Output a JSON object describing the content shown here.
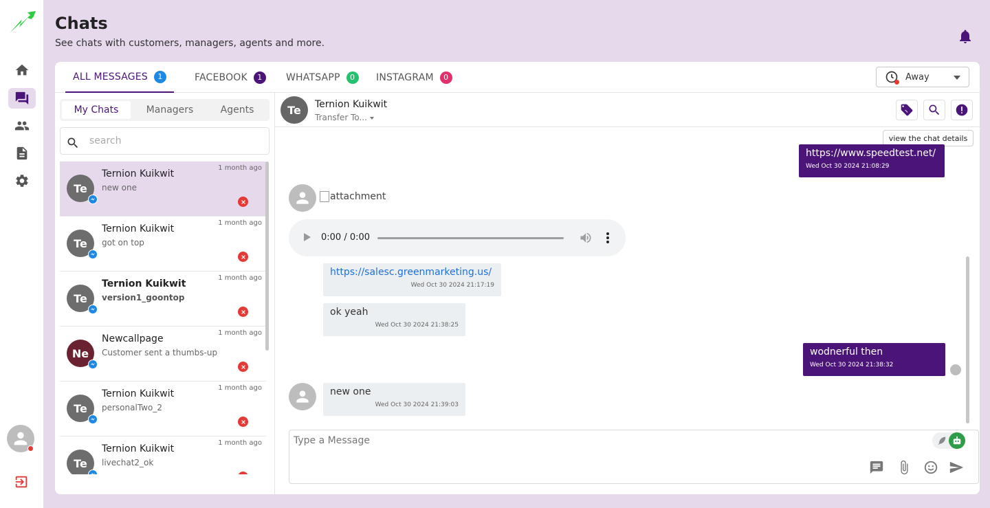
{
  "colors": {
    "brand_purple": "#4a1478",
    "page_bg": "#e6d9ec",
    "messenger_blue": "#1e88e5",
    "alert_red": "#e53935",
    "whatsapp_green": "#25c16f",
    "instagram_pink": "#e0306f",
    "bot_green": "#2e9d4a"
  },
  "header": {
    "title": "Chats",
    "subtitle": "See chats with customers, managers, agents and more."
  },
  "sidebar": {
    "items": [
      {
        "name": "home",
        "icon": "home-icon"
      },
      {
        "name": "chats",
        "icon": "chat-icon"
      },
      {
        "name": "contacts",
        "icon": "people-icon"
      },
      {
        "name": "documents",
        "icon": "document-icon"
      },
      {
        "name": "settings",
        "icon": "gear-icon"
      }
    ]
  },
  "channel_tabs": [
    {
      "label": "ALL MESSAGES",
      "count": "1",
      "color": "#1e88e5"
    },
    {
      "label": "FACEBOOK",
      "count": "1",
      "color": "#4a1478"
    },
    {
      "label": "WHATSAPP",
      "count": "0",
      "color": "#25c16f"
    },
    {
      "label": "INSTAGRAM",
      "count": "0",
      "color": "#e0306f"
    }
  ],
  "status": {
    "selected": "Away"
  },
  "subtabs": [
    "My Chats",
    "Managers",
    "Agents"
  ],
  "search": {
    "placeholder": "search"
  },
  "chats": [
    {
      "name": "Ternion Kuikwit",
      "initials": "Te",
      "preview": "new one",
      "time": "1 month ago",
      "avatar_color": "#6d6d6d",
      "unread": false
    },
    {
      "name": "Ternion Kuikwit",
      "initials": "Te",
      "preview": "got on top",
      "time": "1 month ago",
      "avatar_color": "#6d6d6d",
      "unread": false
    },
    {
      "name": "Ternion Kuikwit",
      "initials": "Te",
      "preview": "version1_goontop",
      "time": "1 month ago",
      "avatar_color": "#6d6d6d",
      "unread": true
    },
    {
      "name": "Newcallpage",
      "initials": "Ne",
      "preview": "Customer sent a thumbs-up",
      "time": "1 month ago",
      "avatar_color": "#6b2230",
      "unread": false
    },
    {
      "name": "Ternion Kuikwit",
      "initials": "Te",
      "preview": "personalTwo_2",
      "time": "1 month ago",
      "avatar_color": "#6d6d6d",
      "unread": false
    },
    {
      "name": "Ternion Kuikwit",
      "initials": "Te",
      "preview": "livechat2_ok",
      "time": "1 month ago",
      "avatar_color": "#6d6d6d",
      "unread": false
    }
  ],
  "conversation": {
    "initials": "Te",
    "name": "Ternion Kuikwit",
    "transfer_label": "Transfer To...",
    "tooltip": "view the chat details",
    "attachment_alt": "attachment",
    "audio_time": "0:00 / 0:00",
    "messages": [
      {
        "direction": "out",
        "text": "https://www.speedtest.net/",
        "timestamp": "Wed Oct 30 2024 21:08:29"
      },
      {
        "direction": "in",
        "text": "https://salesc.greenmarketing.us/",
        "timestamp": "Wed Oct 30 2024 21:17:19",
        "is_link": true
      },
      {
        "direction": "in",
        "text": "ok yeah",
        "timestamp": "Wed Oct 30 2024 21:38:25"
      },
      {
        "direction": "out",
        "text": "wodnerful then",
        "timestamp": "Wed Oct 30 2024 21:38:32"
      },
      {
        "direction": "in",
        "text": "new one",
        "timestamp": "Wed Oct 30 2024 21:39:03"
      }
    ]
  },
  "composer": {
    "placeholder": "Type a Message"
  }
}
